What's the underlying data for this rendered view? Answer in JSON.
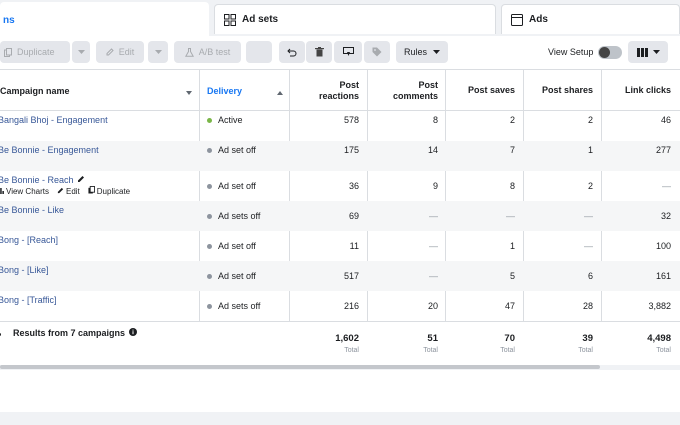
{
  "tabs": {
    "campaigns_partial": "ns",
    "ad_sets": "Ad sets",
    "ads": "Ads"
  },
  "toolbar": {
    "duplicate": "Duplicate",
    "edit": "Edit",
    "ab_test": "A/B test",
    "rules": "Rules",
    "view_setup": "View Setup"
  },
  "columns": {
    "campaign_name": "Campaign name",
    "delivery": "Delivery",
    "post_reactions": "Post reactions",
    "post_comments": "Post comments",
    "post_saves": "Post saves",
    "post_shares": "Post shares",
    "link_clicks": "Link clicks"
  },
  "rows": [
    {
      "name": "Bangali Bhoj - Engagement",
      "delivery": "Active",
      "status": "active",
      "reactions": "578",
      "comments": "8",
      "saves": "2",
      "shares": "2",
      "clicks": "46"
    },
    {
      "name": "Be Bonnie - Engagement",
      "delivery": "Ad set off",
      "status": "off",
      "reactions": "175",
      "comments": "14",
      "saves": "7",
      "shares": "1",
      "clicks": "277"
    },
    {
      "name": "Be Bonnie - Reach",
      "delivery": "Ad set off",
      "status": "off",
      "reactions": "36",
      "comments": "9",
      "saves": "8",
      "shares": "2",
      "clicks": "—"
    },
    {
      "name": "Be Bonnie - Like",
      "delivery": "Ad sets off",
      "status": "off",
      "reactions": "69",
      "comments": "—",
      "saves": "—",
      "shares": "—",
      "clicks": "32"
    },
    {
      "name": "Bong - [Reach]",
      "delivery": "Ad set off",
      "status": "off",
      "reactions": "11",
      "comments": "—",
      "saves": "1",
      "shares": "—",
      "clicks": "100"
    },
    {
      "name": "Bong - [Like]",
      "delivery": "Ad set off",
      "status": "off",
      "reactions": "517",
      "comments": "—",
      "saves": "5",
      "shares": "6",
      "clicks": "161"
    },
    {
      "name": "Bong - [Traffic]",
      "delivery": "Ad sets off",
      "status": "off",
      "reactions": "216",
      "comments": "20",
      "saves": "47",
      "shares": "28",
      "clicks": "3,882"
    }
  ],
  "row_hover_actions": {
    "view_charts": "View Charts",
    "edit": "Edit",
    "duplicate": "Duplicate"
  },
  "totals": {
    "label": "Results from 7 campaigns",
    "sublabel": "Total",
    "reactions": "1,602",
    "comments": "51",
    "saves": "70",
    "shares": "39",
    "clicks": "4,498"
  },
  "colors": {
    "link": "#385898",
    "accent": "#1877f2",
    "active_dot": "#7ab648",
    "off_dot": "#8d949e"
  }
}
